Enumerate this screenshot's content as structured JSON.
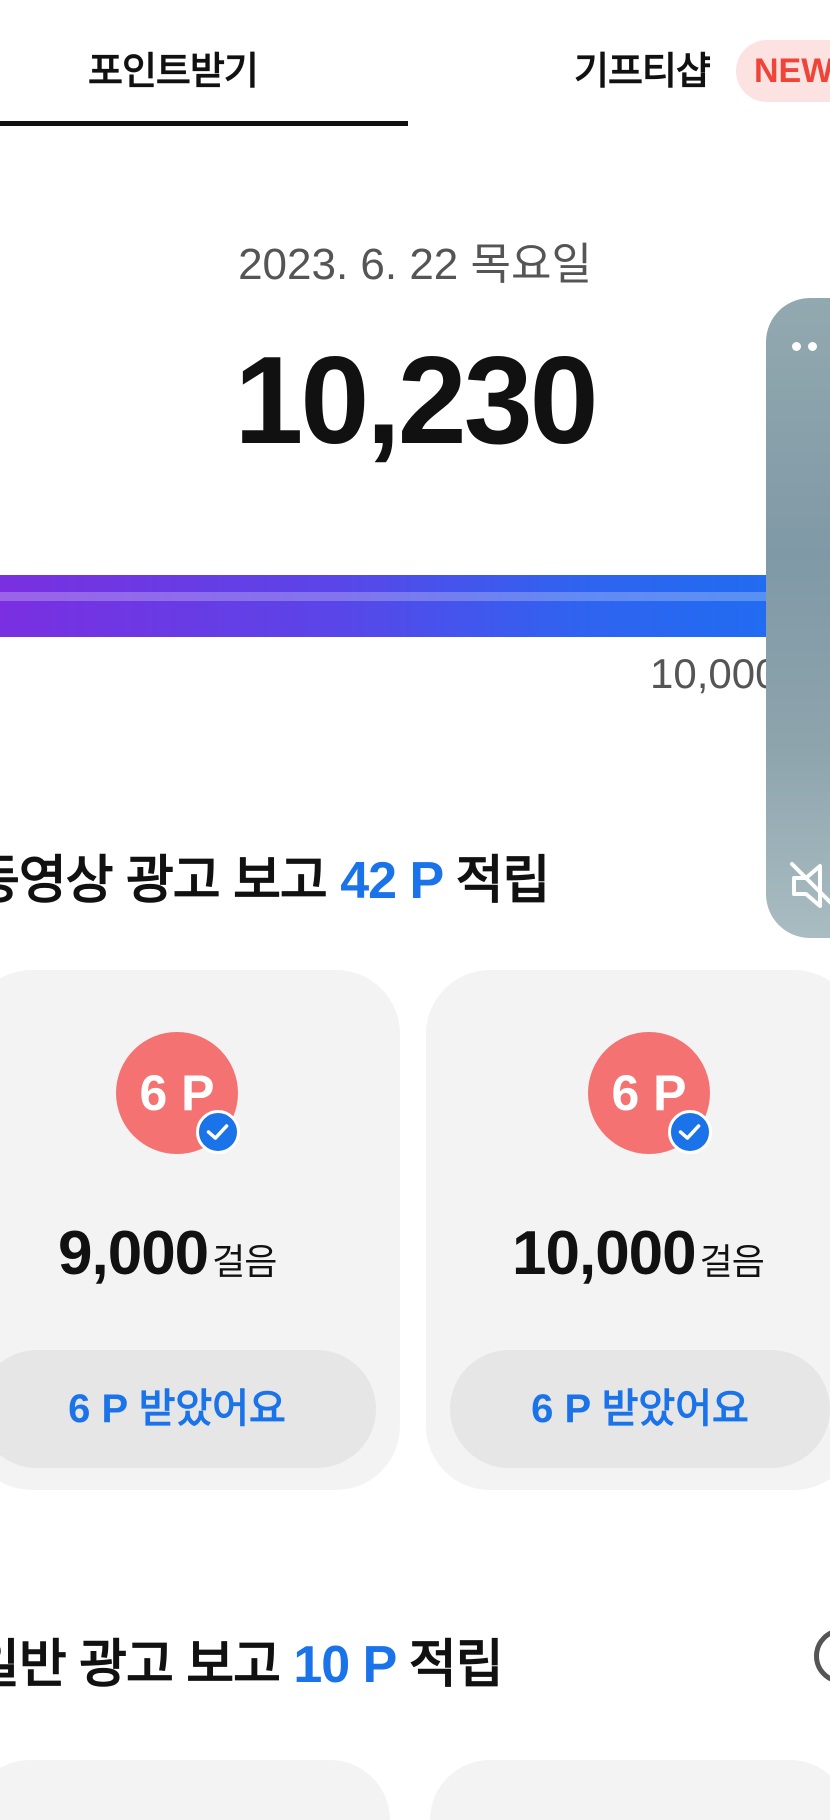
{
  "tabs": {
    "active": "포인트받기",
    "other": "기프티샵",
    "new_badge": "NEW"
  },
  "summary": {
    "date": "2023. 6. 22 목요일",
    "steps": "10,230",
    "goal_label": "10,000",
    "progress_fraction": 1.0
  },
  "video_section": {
    "title_prefix": "동영상 광고 보고",
    "title_points": "42 P",
    "title_suffix": "적립"
  },
  "cards": [
    {
      "badge": "6 P",
      "steps": "9,000",
      "unit": "걸음",
      "button": "6 P 받았어요"
    },
    {
      "badge": "6 P",
      "steps": "10,000",
      "unit": "걸음",
      "button": "6 P 받았어요"
    }
  ],
  "general_section": {
    "title_prefix": "일반 광고 보고",
    "title_points": "10 P",
    "title_suffix": "적립"
  },
  "colors": {
    "accent": "#1a73e8",
    "badge": "#f47272",
    "new_badge_bg": "#fde2e2",
    "new_badge_text": "#f04438"
  },
  "icons": [
    "check-icon",
    "mute-icon",
    "more-icon",
    "help-icon"
  ]
}
